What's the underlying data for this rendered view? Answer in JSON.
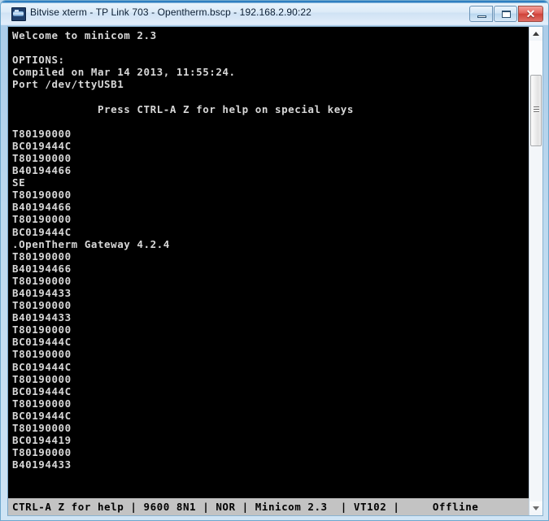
{
  "window": {
    "title": "Bitvise xterm - TP Link 703 - Opentherm.bscp - 192.168.2.90:22",
    "icon": "bitvise-app-icon",
    "controls": {
      "minimize_label": "–",
      "maximize_label": "□",
      "close_label": "✕"
    }
  },
  "terminal": {
    "lines": [
      "Welcome to minicom 2.3",
      "",
      "OPTIONS:",
      "Compiled on Mar 14 2013, 11:55:24.",
      "Port /dev/ttyUSB1",
      "",
      "             Press CTRL-A Z for help on special keys",
      "",
      "T80190000",
      "BC019444C",
      "T80190000",
      "B40194466",
      "SE",
      "T80190000",
      "B40194466",
      "T80190000",
      "BC019444C",
      ".OpenTherm Gateway 4.2.4",
      "T80190000",
      "B40194466",
      "T80190000",
      "B40194433",
      "T80190000",
      "B40194433",
      "T80190000",
      "BC019444C",
      "T80190000",
      "BC019444C",
      "T80190000",
      "BC019444C",
      "T80190000",
      "BC019444C",
      "T80190000",
      "BC0194419",
      "T80190000",
      "B40194433"
    ]
  },
  "statusbar": {
    "text": "CTRL-A Z for help | 9600 8N1 | NOR | Minicom 2.3  | VT102 |     Offline",
    "fields": {
      "help": "CTRL-A Z for help",
      "baud": "9600 8N1",
      "flow": "NOR",
      "program": "Minicom 2.3",
      "emulation": "VT102",
      "connection": "Offline",
      "separator": "|"
    }
  },
  "scrollbar": {
    "up_arrow": "scroll-up-arrow",
    "down_arrow": "scroll-down-arrow",
    "thumb": "scroll-thumb"
  },
  "colors": {
    "terminal_bg": "#000000",
    "terminal_fg": "#d7d7d7",
    "statusbar_bg": "#c3c3c3",
    "statusbar_fg": "#000000",
    "frame": "#bcd9ef",
    "close_button": "#cf4239"
  }
}
